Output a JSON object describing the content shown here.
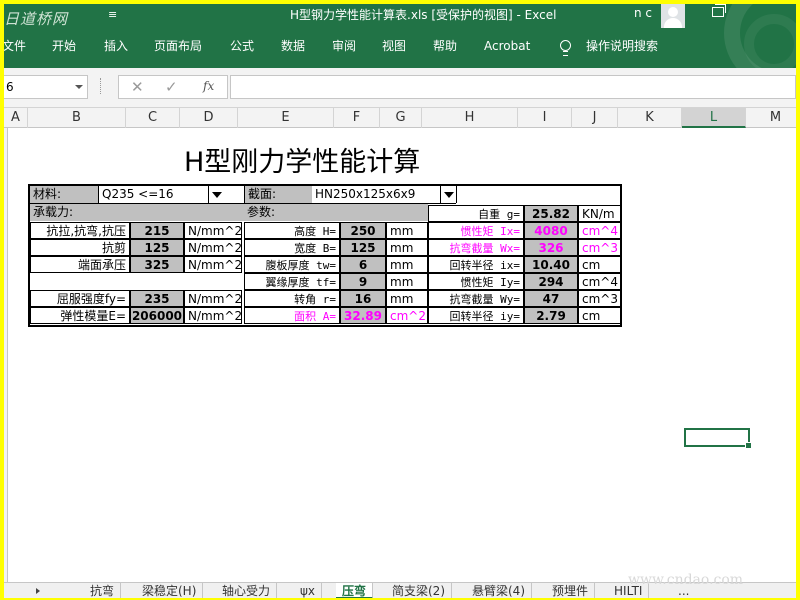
{
  "titlebar": {
    "logo": "日道桥网",
    "qat": "≡",
    "title": "H型钢力学性能计算表.xls  [受保护的视图]  -  Excel",
    "user": "n c"
  },
  "ribbon_tabs": [
    "文件",
    "开始",
    "插入",
    "页面布局",
    "公式",
    "数据",
    "审阅",
    "视图",
    "帮助",
    "Acrobat",
    "操作说明搜索"
  ],
  "formula_bar": {
    "name_box": "6",
    "cancel": "✕",
    "enter": "✓",
    "fx": "fx",
    "value": ""
  },
  "columns": [
    "A",
    "B",
    "C",
    "D",
    "E",
    "F",
    "G",
    "H",
    "I",
    "J",
    "K",
    "L",
    "M"
  ],
  "selected_column": "L",
  "sheet": {
    "title": "H型刚力学性能计算",
    "material_label": "材料:",
    "material_value": "Q235  <=16",
    "section_label": "截面:",
    "section_value": "HN250x125x6x9",
    "capacity_label": "承载力:",
    "params_label": "参数:",
    "capacity_rows": [
      {
        "label": "抗拉,抗弯,抗压",
        "value": "215",
        "unit": "N/mm^2"
      },
      {
        "label": "抗剪",
        "value": "125",
        "unit": "N/mm^2"
      },
      {
        "label": "端面承压",
        "value": "325",
        "unit": "N/mm^2"
      },
      {
        "label": "屈服强度fy=",
        "value": "235",
        "unit": "N/mm^2"
      },
      {
        "label": "弹性模量E=",
        "value": "206000",
        "unit": "N/mm^2"
      }
    ],
    "param_rows": [
      {
        "label": "高度 H=",
        "value": "250",
        "unit": "mm"
      },
      {
        "label": "宽度 B=",
        "value": "125",
        "unit": "mm"
      },
      {
        "label": "腹板厚度 tw=",
        "value": "6",
        "unit": "mm"
      },
      {
        "label": "翼缘厚度 tf=",
        "value": "9",
        "unit": "mm"
      },
      {
        "label": "转角 r=",
        "value": "16",
        "unit": "mm"
      },
      {
        "label": "面积 A=",
        "value": "32.89",
        "unit": "cm^2"
      }
    ],
    "prop_rows": [
      {
        "label": "自重 g=",
        "value": "25.82",
        "unit": "KN/m"
      },
      {
        "label": "惯性矩 Ix=",
        "value": "4080",
        "unit": "cm^4"
      },
      {
        "label": "抗弯截量 Wx=",
        "value": "326",
        "unit": "cm^3"
      },
      {
        "label": "回转半径 ix=",
        "value": "10.40",
        "unit": "cm"
      },
      {
        "label": "惯性矩 Iy=",
        "value": "294",
        "unit": "cm^4"
      },
      {
        "label": "抗弯截量 Wy=",
        "value": "47",
        "unit": "cm^3"
      },
      {
        "label": "回转半径 iy=",
        "value": "2.79",
        "unit": "cm"
      }
    ],
    "highlight_color": "#ff00ff"
  },
  "sheet_tabs": [
    "抗弯",
    "梁稳定(H)",
    "轴心受力",
    "ψx",
    "压弯",
    "简支梁(2)",
    "悬臂梁(4)",
    "预埋件",
    "HILTI"
  ],
  "active_sheet": "压弯",
  "sheet_tabs_more": "...",
  "watermark": "www.cndao.com",
  "colors": {
    "excel_green": "#217346",
    "frame_yellow": "#ffff00",
    "input_gray": "#c0c0c0"
  }
}
